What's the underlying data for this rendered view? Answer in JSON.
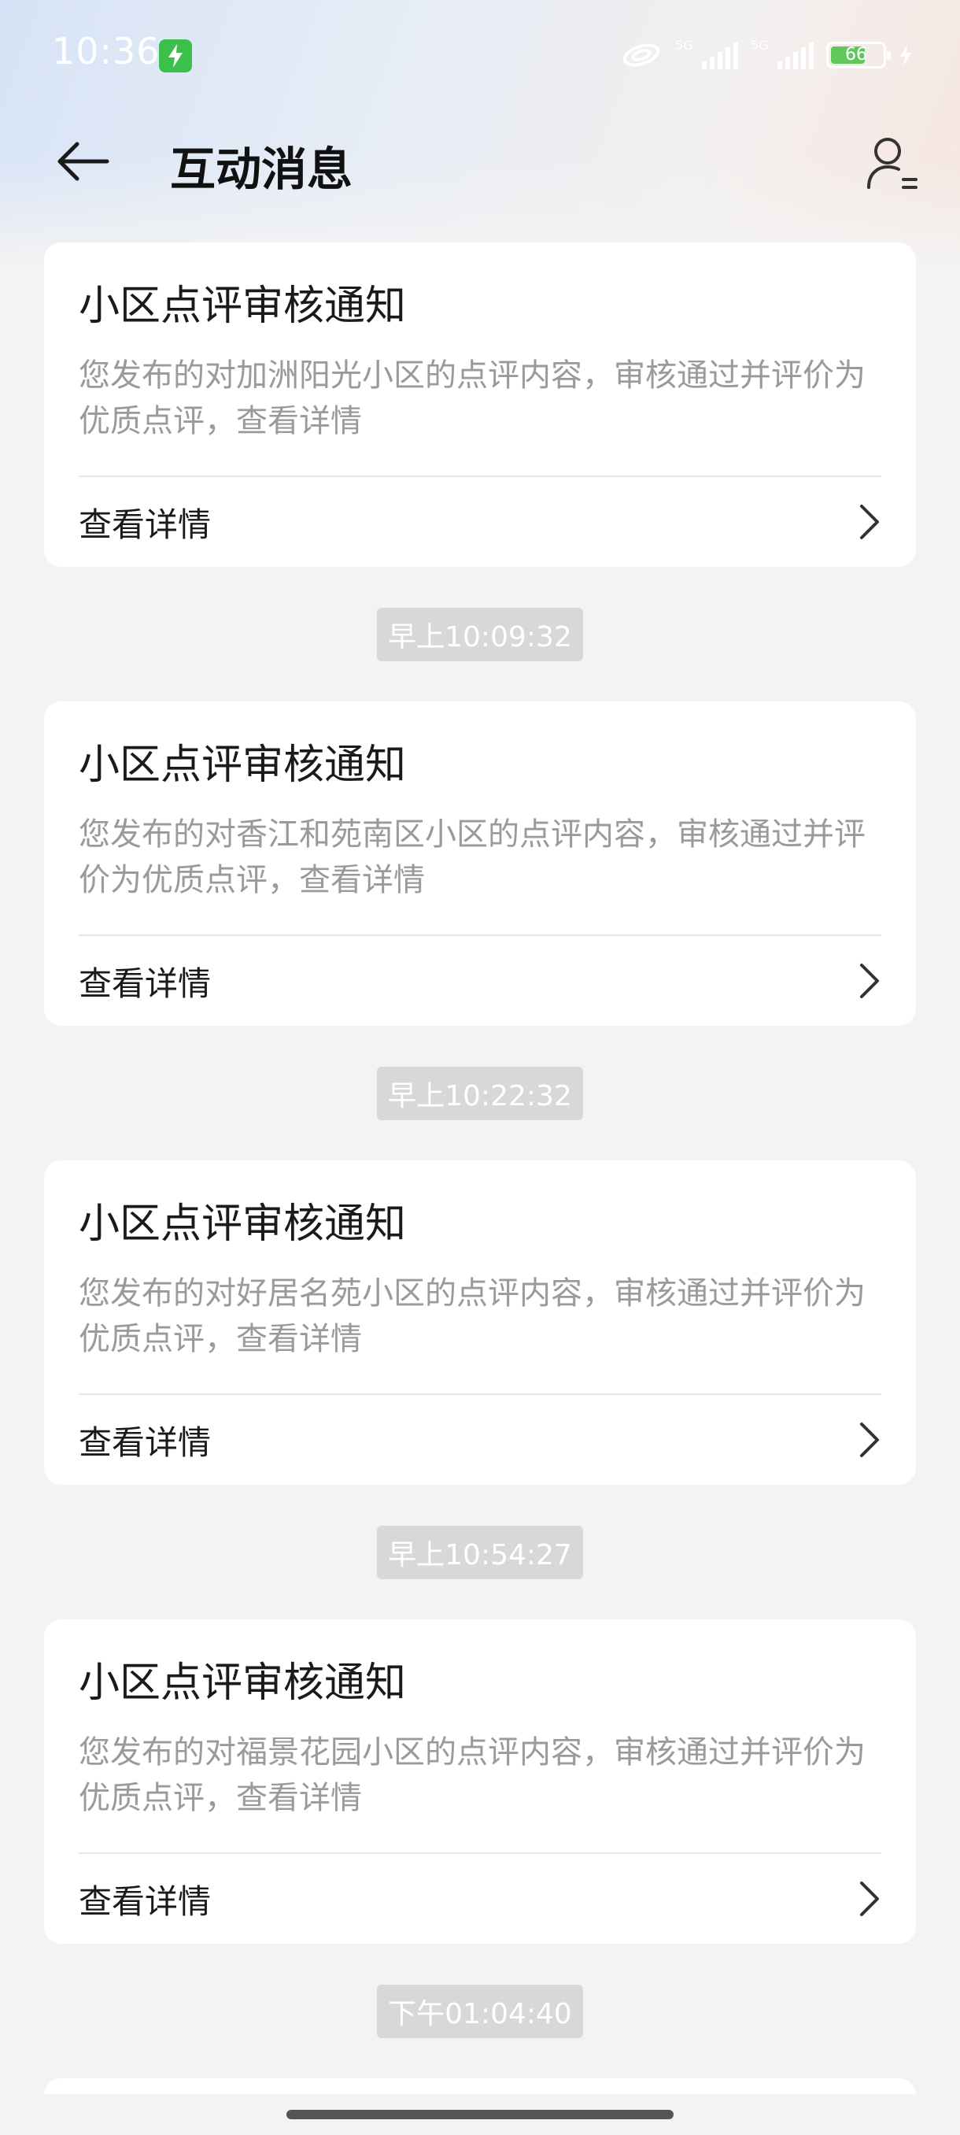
{
  "status_bar": {
    "time": "10:36",
    "network_1": "5G",
    "network_2": "5G",
    "battery": "66"
  },
  "header": {
    "title": "互动消息"
  },
  "messages": [
    {
      "title": "小区点评审核通知",
      "body": "您发布的对加洲阳光小区的点评内容，审核通过并评价为优质点评，查看详情",
      "link_label": "查看详情"
    },
    {
      "timestamp": "早上10:09:32",
      "title": "小区点评审核通知",
      "body": "您发布的对香江和苑南区小区的点评内容，审核通过并评价为优质点评，查看详情",
      "link_label": "查看详情"
    },
    {
      "timestamp": "早上10:22:32",
      "title": "小区点评审核通知",
      "body": "您发布的对好居名苑小区的点评内容，审核通过并评价为优质点评，查看详情",
      "link_label": "查看详情"
    },
    {
      "timestamp": "早上10:54:27",
      "title": "小区点评审核通知",
      "body": "您发布的对福景花园小区的点评内容，审核通过并评价为优质点评，查看详情",
      "link_label": "查看详情"
    }
  ],
  "last_timestamp": "下午01:04:40",
  "icons": {
    "back": "arrow-left-icon",
    "profile": "user-list-icon",
    "chevron": "chevron-right-icon",
    "charging": "lightning-icon"
  },
  "colors": {
    "charging_badge": "#3dbf4b",
    "battery_fill": "#60c75b",
    "timestamp_bg": "#d8d8d8",
    "body_text": "#9a9a9a"
  }
}
